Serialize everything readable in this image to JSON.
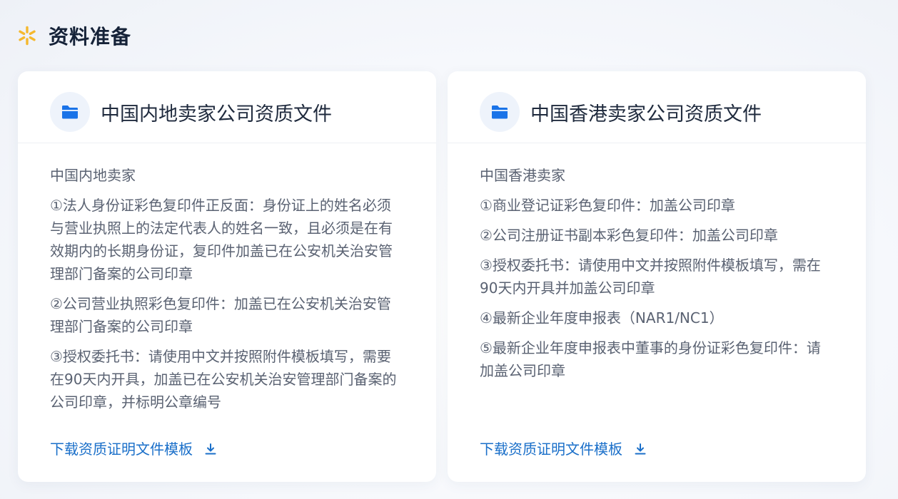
{
  "section": {
    "title": "资料准备"
  },
  "cards": [
    {
      "title": "中国内地卖家公司资质文件",
      "group_label": "中国内地卖家",
      "items": [
        "①法人身份证彩色复印件正反面：身份证上的姓名必须与营业执照上的法定代表人的姓名一致，且必须是在有效期内的长期身份证，复印件加盖已在公安机关治安管理部门备案的公司印章",
        "②公司营业执照彩色复印件：加盖已在公安机关治安管理部门备案的公司印章",
        "③授权委托书：请使用中文并按照附件模板填写，需要在90天内开具，加盖已在公安机关治安管理部门备案的公司印章，并标明公章编号"
      ],
      "download_label": "下载资质证明文件模板"
    },
    {
      "title": "中国香港卖家公司资质文件",
      "group_label": "中国香港卖家",
      "items": [
        "①商业登记证彩色复印件：加盖公司印章",
        "②公司注册证书副本彩色复印件：加盖公司印章",
        "③授权委托书：请使用中文并按照附件模板填写，需在90天内开具并加盖公司印章",
        "④最新企业年度申报表（NAR1/NC1）",
        "⑤最新企业年度申报表中董事的身份证彩色复印件：请加盖公司印章"
      ],
      "download_label": "下载资质证明文件模板"
    }
  ],
  "colors": {
    "accent": "#1a6fc9",
    "folder_icon": "#1a73e8",
    "spark_icon": "#f5b82e",
    "title": "#152238",
    "body_text": "#5a6272"
  },
  "icons": {
    "section": "spark-icon",
    "card": "folder-icon",
    "download": "download-icon"
  }
}
